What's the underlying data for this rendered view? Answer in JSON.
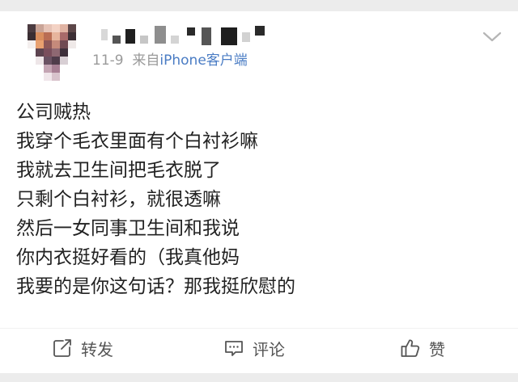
{
  "post": {
    "date": "11-9",
    "source_prefix": "来自",
    "source_device": "iPhone客户端",
    "lines": [
      "公司贼热",
      "我穿个毛衣里面有个白衬衫嘛",
      "我就去卫生间把毛衣脱了",
      "只剩个白衬衫，就很透嘛",
      "然后一女同事卫生间和我说",
      "你内衣挺好看的（我真他妈",
      "我要的是你这句话？那我挺欣慰的"
    ]
  },
  "actions": {
    "repost_label": "转发",
    "comment_label": "评论",
    "like_label": "赞"
  },
  "icons": {
    "menu": "chevron-down-icon",
    "repost": "share-icon",
    "comment": "comment-icon",
    "like": "thumbs-up-icon"
  },
  "colors": {
    "text": "#222222",
    "meta": "#9a9a9a",
    "source_link": "#4a7cc4",
    "action_text": "#555555"
  }
}
